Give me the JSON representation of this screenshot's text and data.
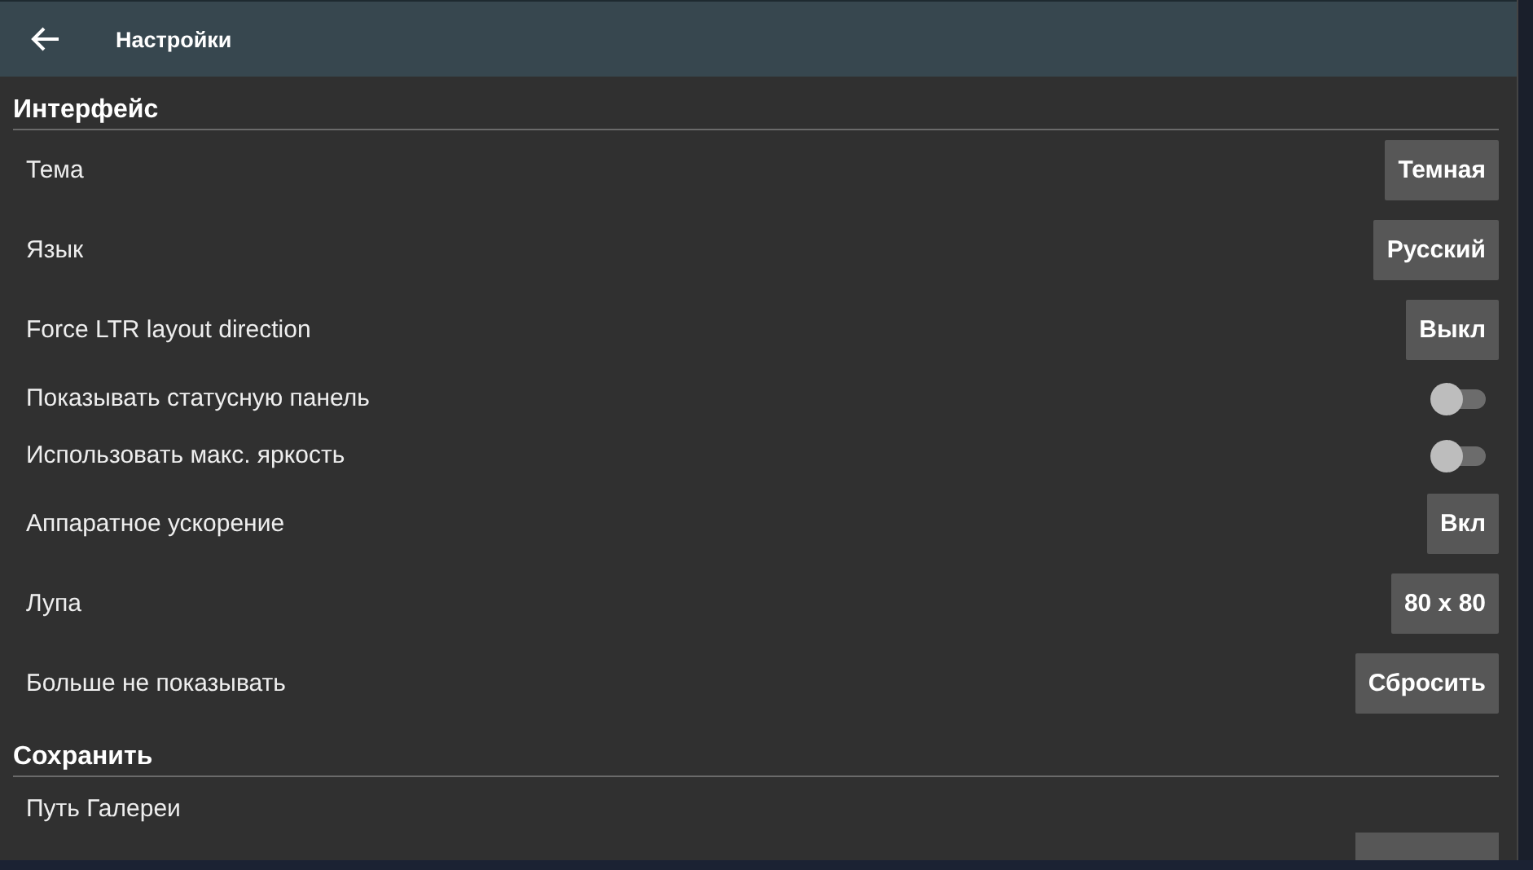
{
  "toolbar": {
    "title": "Настройки"
  },
  "sections": [
    {
      "title": "Интерфейс",
      "items": [
        {
          "kind": "button",
          "label": "Тема",
          "value": "Темная"
        },
        {
          "kind": "button",
          "label": "Язык",
          "value": "Русский"
        },
        {
          "kind": "button",
          "label": "Force LTR layout direction",
          "value": "Выкл"
        },
        {
          "kind": "toggle",
          "label": "Показывать статусную панель",
          "on": false
        },
        {
          "kind": "toggle",
          "label": "Использовать макс. яркость",
          "on": false
        },
        {
          "kind": "button",
          "label": "Аппаратное ускорение",
          "value": "Вкл"
        },
        {
          "kind": "button",
          "label": "Лупа",
          "value": "80 x 80"
        },
        {
          "kind": "button",
          "label": "Больше не показывать",
          "value": "Сбросить"
        }
      ]
    },
    {
      "title": "Сохранить",
      "items": [
        {
          "kind": "path",
          "label": "Путь Галереи"
        }
      ]
    }
  ]
}
